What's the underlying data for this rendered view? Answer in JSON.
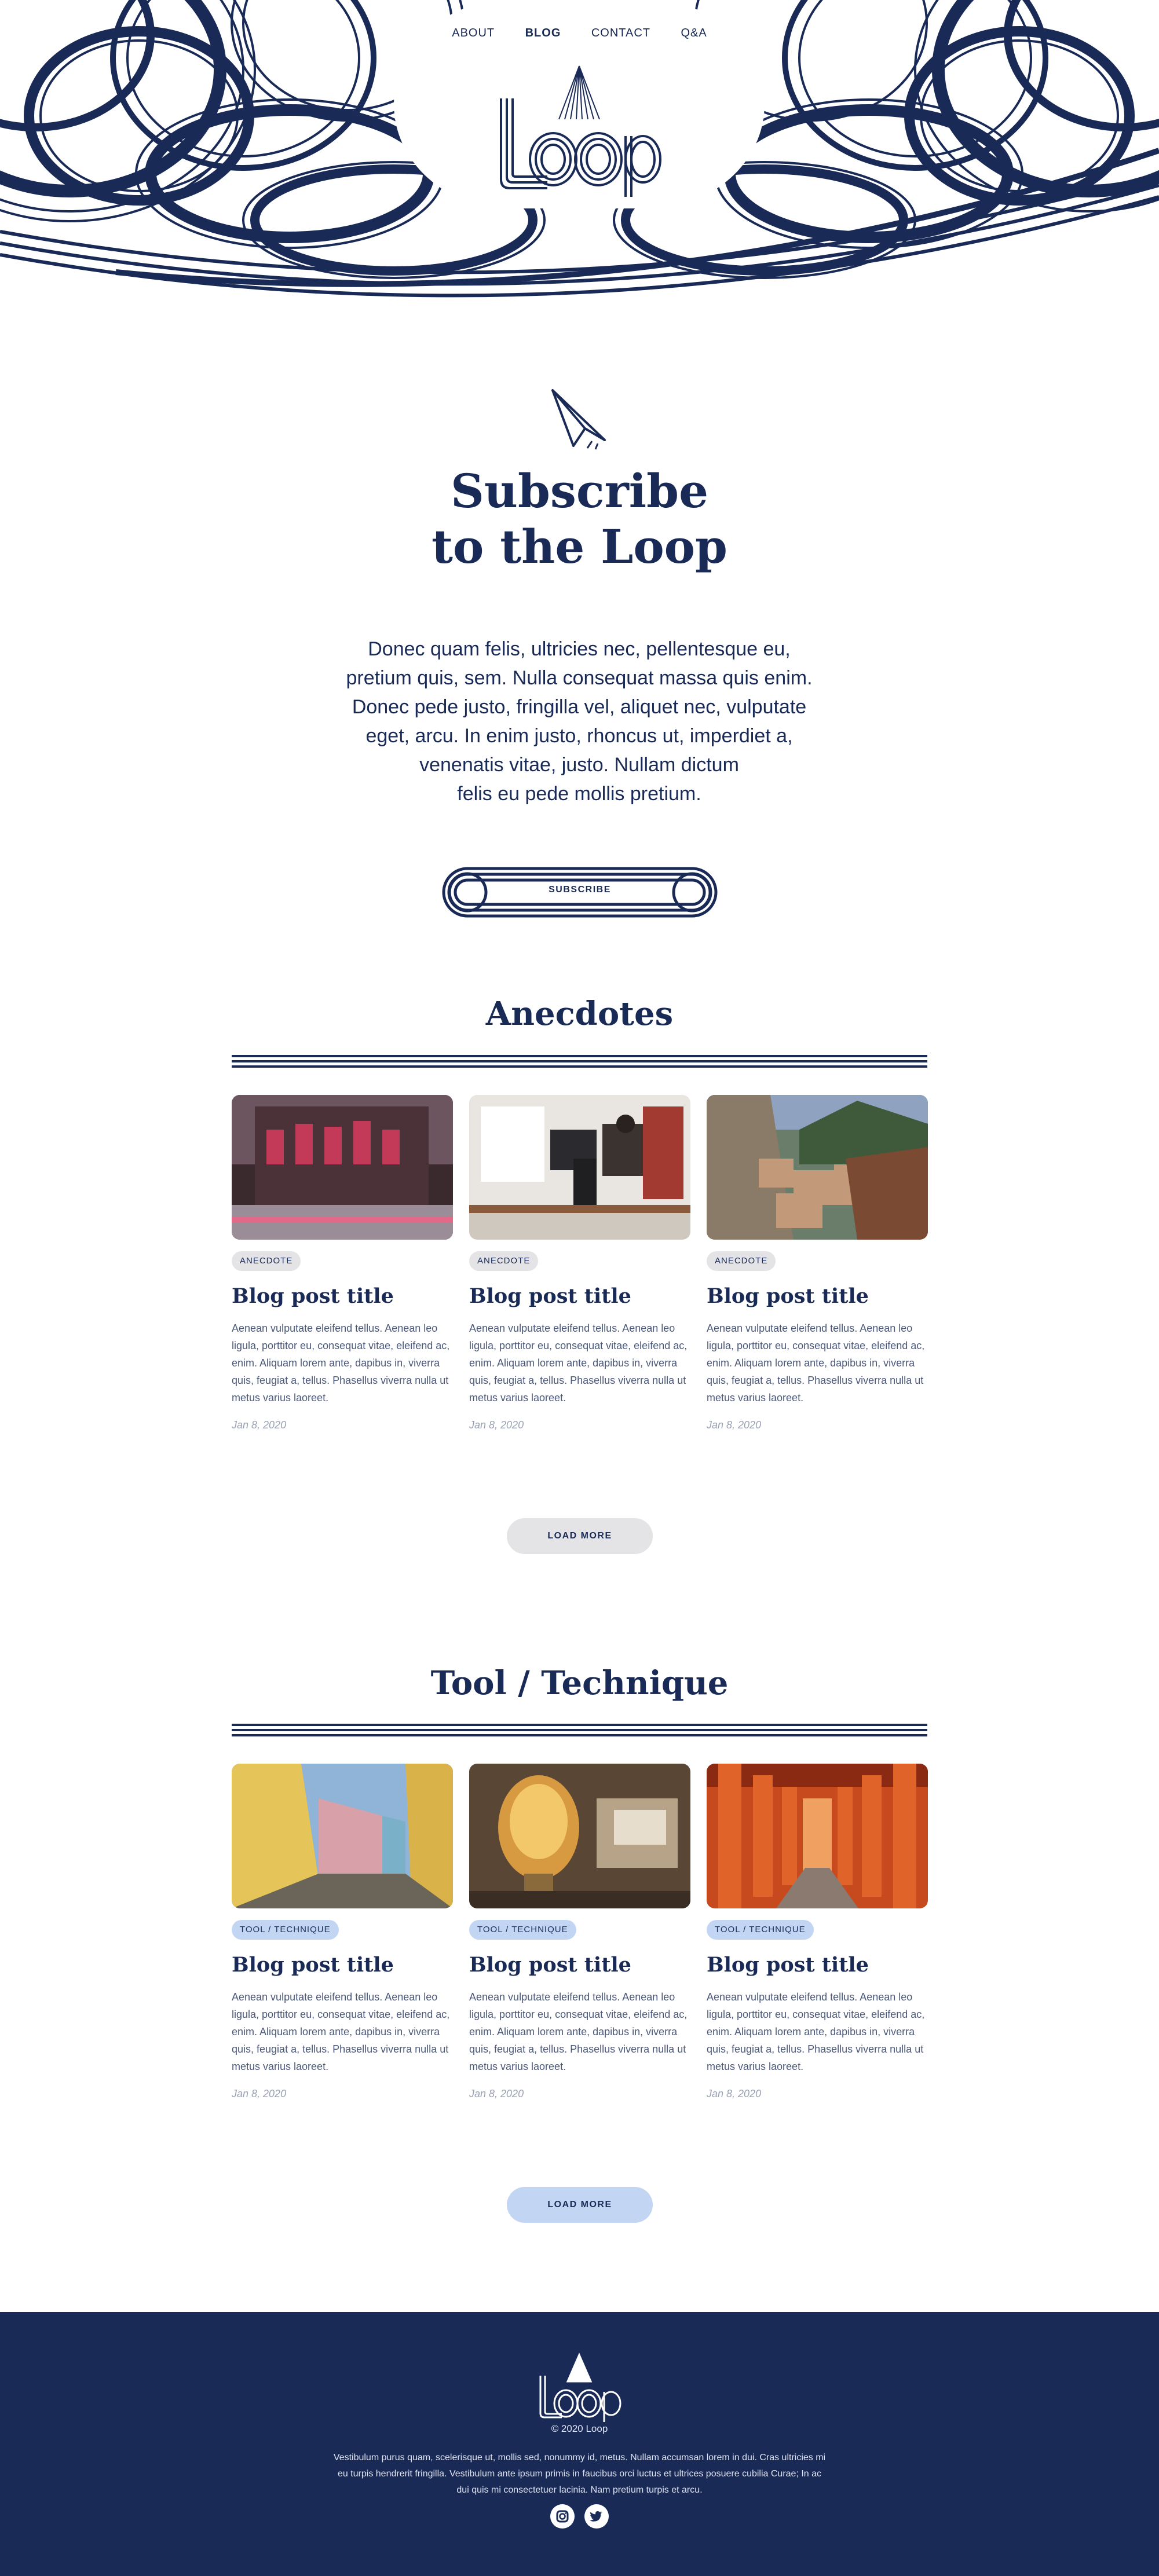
{
  "nav": {
    "items": [
      "ABOUT",
      "BLOG",
      "CONTACT",
      "Q&A"
    ],
    "active_index": 1
  },
  "brand": {
    "logo_text": "Loop"
  },
  "subscribe": {
    "title_line1": "Subscribe",
    "title_line2": "to the Loop",
    "text_lines": [
      "Donec quam felis, ultricies nec, pellentesque eu,",
      "pretium quis, sem. Nulla consequat massa quis enim.",
      "Donec pede justo, fringilla vel, aliquet nec, vulputate",
      "eget, arcu. In enim justo, rhoncus ut, imperdiet a,",
      "venenatis vitae, justo. Nullam dictum",
      "felis eu pede mollis pretium."
    ],
    "button_label": "SUBSCRIBE"
  },
  "sections": [
    {
      "title": "Anecdotes",
      "tag_style": "gray",
      "load_more_label": "LOAD MORE",
      "posts": [
        {
          "tag": "ANECDOTE",
          "title": "Blog post title",
          "excerpt": "Aenean vulputate eleifend tellus. Aenean leo ligula, porttitor eu, consequat vitae, eleifend ac, enim. Aliquam lorem ante, dapibus in, viverra quis, feugiat a, tellus. Phasellus viverra nulla ut metus varius laoreet.",
          "date": "Jan 8, 2020",
          "image": "city-street-night"
        },
        {
          "tag": "ANECDOTE",
          "title": "Blog post title",
          "excerpt": "Aenean vulputate eleifend tellus. Aenean leo ligula, porttitor eu, consequat vitae, eleifend ac, enim. Aliquam lorem ante, dapibus in, viverra quis, feugiat a, tellus. Phasellus viverra nulla ut metus varius laoreet.",
          "date": "Jan 8, 2020",
          "image": "office-workspace"
        },
        {
          "tag": "ANECDOTE",
          "title": "Blog post title",
          "excerpt": "Aenean vulputate eleifend tellus. Aenean leo ligula, porttitor eu, consequat vitae, eleifend ac, enim. Aliquam lorem ante, dapibus in, viverra quis, feugiat a, tellus. Phasellus viverra nulla ut metus varius laoreet.",
          "date": "Jan 8, 2020",
          "image": "mountain-village"
        }
      ]
    },
    {
      "title": "Tool / Technique",
      "tag_style": "blue",
      "load_more_label": "LOAD MORE",
      "posts": [
        {
          "tag": "TOOL / TECHNIQUE",
          "title": "Blog post title",
          "excerpt": "Aenean vulputate eleifend tellus. Aenean leo ligula, porttitor eu, consequat vitae, eleifend ac, enim. Aliquam lorem ante, dapibus in, viverra quis, feugiat a, tellus. Phasellus viverra nulla ut metus varius laoreet.",
          "date": "Jan 8, 2020",
          "image": "colorful-street"
        },
        {
          "tag": "TOOL / TECHNIQUE",
          "title": "Blog post title",
          "excerpt": "Aenean vulputate eleifend tellus. Aenean leo ligula, porttitor eu, consequat vitae, eleifend ac, enim. Aliquam lorem ante, dapibus in, viverra quis, feugiat a, tellus. Phasellus viverra nulla ut metus varius laoreet.",
          "date": "Jan 8, 2020",
          "image": "light-bulb"
        },
        {
          "tag": "TOOL / TECHNIQUE",
          "title": "Blog post title",
          "excerpt": "Aenean vulputate eleifend tellus. Aenean leo ligula, porttitor eu, consequat vitae, eleifend ac, enim. Aliquam lorem ante, dapibus in, viverra quis, feugiat a, tellus. Phasellus viverra nulla ut metus varius laoreet.",
          "date": "Jan 8, 2020",
          "image": "torii-gates"
        }
      ]
    }
  ],
  "footer": {
    "copyright": "© 2020 Loop",
    "text_lines": [
      "Vestibulum purus quam, scelerisque ut, mollis sed, nonummy id, metus. Nullam accumsan lorem in dui. Cras ultricies mi",
      "eu turpis hendrerit fringilla. Vestibulum ante ipsum primis in faucibus orci luctus et ultrices posuere cubilia Curae; In ac",
      "dui quis mi consectetuer lacinia. Nam pretium turpis et arcu."
    ],
    "social": [
      "instagram-icon",
      "twitter-icon"
    ]
  },
  "colors": {
    "navy": "#1a2a57",
    "tag_gray": "#e4e4e6",
    "tag_blue": "#c2d6f3",
    "footer_text": "#dfe5f4"
  }
}
